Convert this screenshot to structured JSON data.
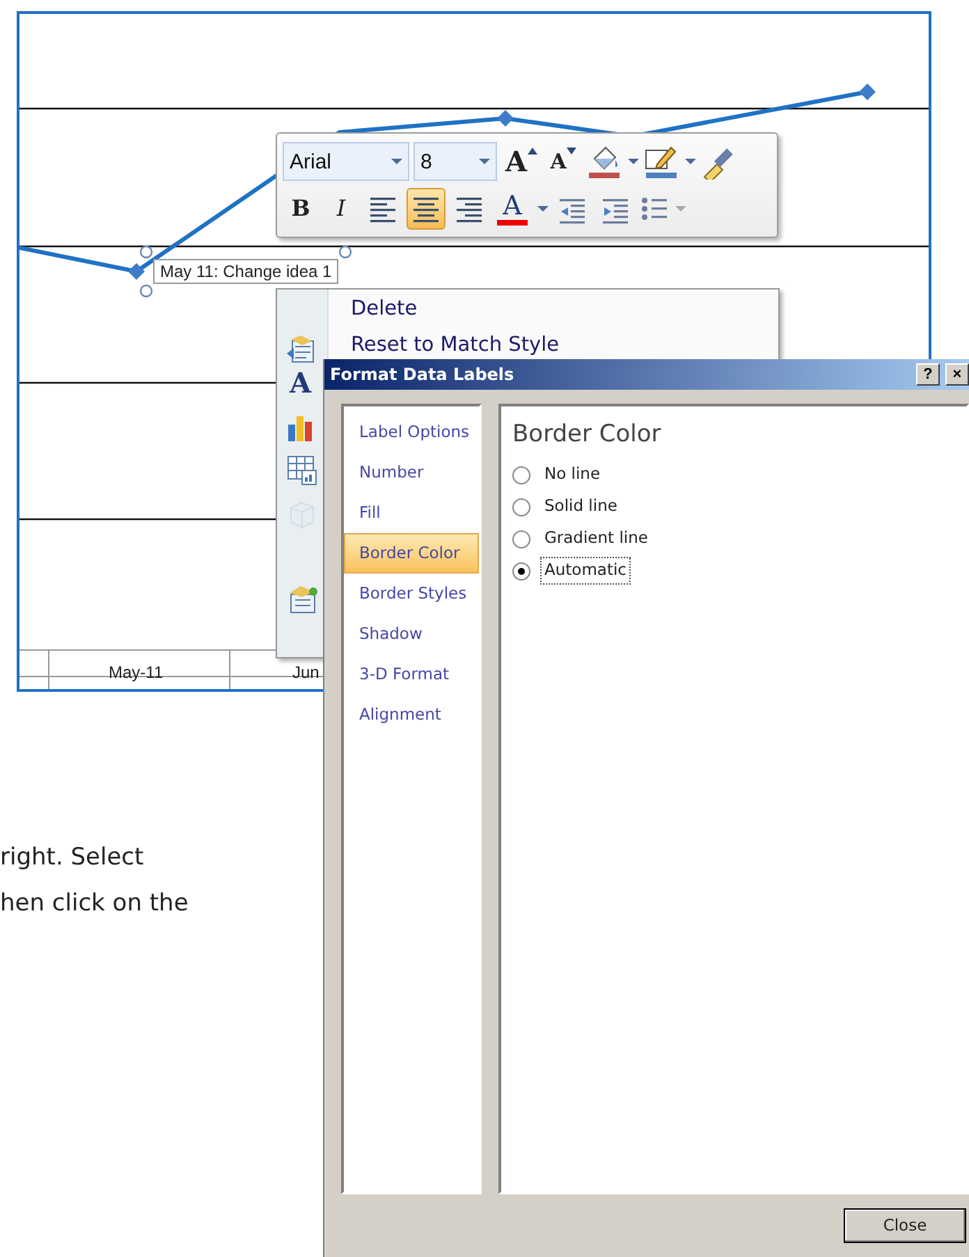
{
  "chart": {
    "data_label": "May 11: Change idea 1",
    "axis_labels": [
      "May-11",
      "Jun"
    ]
  },
  "mini_toolbar": {
    "rows": [
      [
        {
          "kind": "font",
          "value": "Arial"
        },
        {
          "kind": "size",
          "value": "8"
        },
        {
          "kind": "grow",
          "label": "A"
        },
        {
          "kind": "shrink",
          "label": "A"
        },
        {
          "kind": "fill"
        },
        {
          "kind": "line"
        },
        {
          "kind": "painter"
        }
      ],
      [
        {
          "kind": "bold",
          "label": "B"
        },
        {
          "kind": "italic",
          "label": "I"
        },
        {
          "kind": "align-left",
          "selected": false
        },
        {
          "kind": "align-center",
          "selected": true
        },
        {
          "kind": "align-right",
          "selected": false
        },
        {
          "kind": "font-color",
          "label": "A"
        },
        {
          "kind": "outdent"
        },
        {
          "kind": "indent"
        },
        {
          "kind": "bullets"
        }
      ]
    ]
  },
  "context_menu": {
    "rows": [
      {
        "label": "Delete"
      },
      {
        "label": "Reset to Match Style",
        "kind": "reset"
      },
      {
        "kind": "font",
        "icon_label": "A"
      },
      {
        "kind": "chart"
      },
      {
        "kind": "data-table"
      },
      {
        "kind": "cube",
        "disabled": true
      },
      {},
      {
        "kind": "format"
      }
    ]
  },
  "dialog": {
    "title": "Format Data Labels",
    "title_buttons": [
      "?",
      "×"
    ],
    "categories": [
      {
        "label": "Label Options",
        "selected": false
      },
      {
        "label": "Number",
        "selected": false
      },
      {
        "label": "Fill",
        "selected": false
      },
      {
        "label": "Border Color",
        "selected": true
      },
      {
        "label": "Border Styles",
        "selected": false
      },
      {
        "label": "Shadow",
        "selected": false
      },
      {
        "label": "3-D Format",
        "selected": false
      },
      {
        "label": "Alignment",
        "selected": false
      }
    ],
    "heading": "Border Color",
    "options": [
      {
        "label": "No line",
        "selected": false
      },
      {
        "label": "Solid line",
        "selected": false
      },
      {
        "label": "Gradient line",
        "selected": false
      },
      {
        "label": "Automatic",
        "selected": true
      }
    ],
    "buttons": [
      "Close"
    ]
  },
  "background_text": [
    "right. Select",
    "hen click on the"
  ]
}
